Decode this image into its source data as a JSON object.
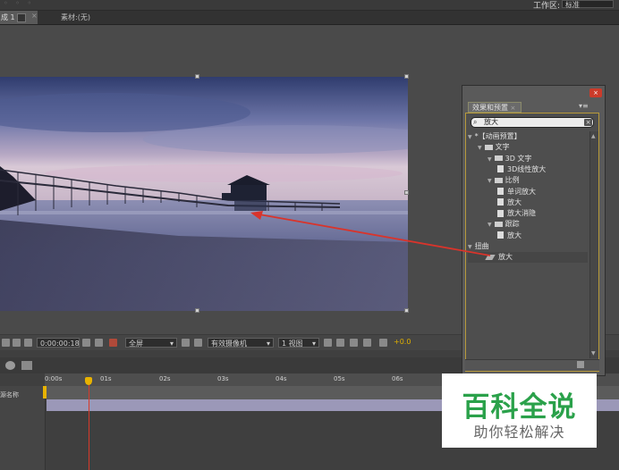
{
  "top_bar": {
    "workspace_label": "工作区:",
    "workspace_value": "标准"
  },
  "tabs": {
    "comp_tab": "成 1",
    "footage_tab": "素材:(无)"
  },
  "viewer_toolbar": {
    "timecode": "0:00:00:18",
    "resolution": "全屏",
    "camera": "有效摄像机",
    "views": "1 视图",
    "exposure": "+0.0"
  },
  "timeline": {
    "layer_label": "源名称",
    "ruler_ticks": [
      "0:00s",
      "01s",
      "02s",
      "03s",
      "04s",
      "05s",
      "06s"
    ]
  },
  "effects_panel": {
    "tab_label": "效果和预置",
    "search_value": "放大",
    "tree": [
      {
        "label": "*【动画预置】",
        "depth": 0,
        "kind": "group"
      },
      {
        "label": "文字",
        "depth": 1,
        "kind": "folder"
      },
      {
        "label": "3D 文字",
        "depth": 2,
        "kind": "folder"
      },
      {
        "label": "3D线性放大",
        "depth": 3,
        "kind": "preset"
      },
      {
        "label": "比例",
        "depth": 2,
        "kind": "folder"
      },
      {
        "label": "单词放大",
        "depth": 3,
        "kind": "preset"
      },
      {
        "label": "放大",
        "depth": 3,
        "kind": "preset"
      },
      {
        "label": "放大消隐",
        "depth": 3,
        "kind": "preset"
      },
      {
        "label": "跟踪",
        "depth": 2,
        "kind": "folder"
      },
      {
        "label": "放大",
        "depth": 3,
        "kind": "preset"
      },
      {
        "label": "扭曲",
        "depth": 0,
        "kind": "category"
      },
      {
        "label": "放大",
        "depth": 1,
        "kind": "effect"
      }
    ]
  },
  "watermark": {
    "title": "百科全说",
    "subtitle": "助你轻松解决"
  },
  "colors": {
    "accent": "#e8b200",
    "arrow": "#d9342b",
    "watermark_green": "#2aa14a"
  }
}
